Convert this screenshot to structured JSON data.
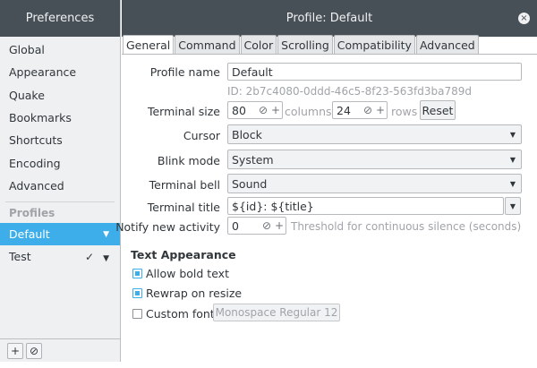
{
  "sidebar": {
    "title": "Preferences",
    "items": [
      "Global",
      "Appearance",
      "Quake",
      "Bookmarks",
      "Shortcuts",
      "Encoding",
      "Advanced"
    ],
    "profiles_label": "Profiles",
    "profiles": [
      {
        "name": "Default",
        "selected": true
      },
      {
        "name": "Test",
        "selected": false,
        "check": "✓"
      }
    ],
    "footer": {
      "add_icon": "+",
      "remove_icon": "⊘"
    }
  },
  "main": {
    "title": "Profile: Default",
    "close_icon": "×",
    "tabs": [
      "General",
      "Command",
      "Color",
      "Scrolling",
      "Compatibility",
      "Advanced"
    ],
    "active_tab": "General",
    "profile_name": {
      "label": "Profile name",
      "value": "Default"
    },
    "profile_id": "ID: 2b7c4080-0ddd-46c5-8f23-563fd3ba789d",
    "terminal_size": {
      "label": "Terminal size",
      "columns_value": "80",
      "columns_label": "columns",
      "rows_value": "24",
      "rows_label": "rows",
      "reset_label": "Reset"
    },
    "cursor": {
      "label": "Cursor",
      "value": "Block"
    },
    "blink_mode": {
      "label": "Blink mode",
      "value": "System"
    },
    "terminal_bell": {
      "label": "Terminal bell",
      "value": "Sound"
    },
    "terminal_title": {
      "label": "Terminal title",
      "value": "${id}: ${title}"
    },
    "notify_activity": {
      "label": "Notify new activity",
      "value": "0",
      "hint": "Threshold for continuous silence (seconds)"
    },
    "text_appearance": {
      "title": "Text Appearance",
      "allow_bold": {
        "label": "Allow bold text",
        "checked": true
      },
      "rewrap": {
        "label": "Rewrap on resize",
        "checked": true
      },
      "custom_font": {
        "label": "Custom font",
        "checked": false,
        "font_value": "Monospace Regular  12"
      }
    },
    "spin_clear_icon": "⊘",
    "spin_plus_icon": "+",
    "dropdown_arrow": "▼"
  },
  "colors": {
    "accent": "#3daee9",
    "header_bg": "#475057",
    "sidebar_bg": "#eff0f1"
  }
}
